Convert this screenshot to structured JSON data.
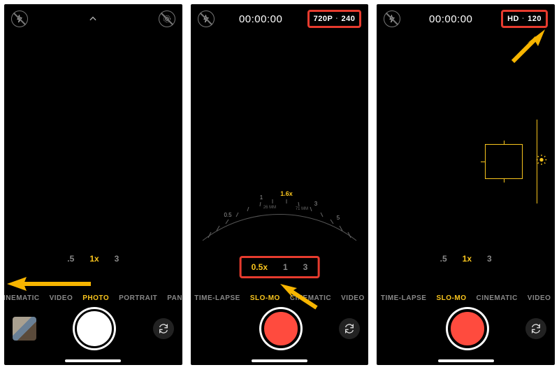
{
  "phone1": {
    "zoom": {
      "a": ".5",
      "b": "1x",
      "c": "3"
    },
    "modes": {
      "a": "CINEMATIC",
      "b": "VIDEO",
      "c": "PHOTO",
      "d": "PORTRAIT",
      "e": "PANO"
    }
  },
  "phone2": {
    "timer": "00:00:00",
    "res_a": "720P",
    "res_b": "240",
    "dial": {
      "l05": "0.5",
      "l1": "1",
      "l16": "1.6x",
      "l16mm": "26 MM",
      "l71mm": "71 MM",
      "l3": "3",
      "l5": "5"
    },
    "zoom": {
      "a": "0.5x",
      "b": "1",
      "c": "3"
    },
    "modes": {
      "a": "TIME-LAPSE",
      "b": "SLO-MO",
      "c": "CINEMATIC",
      "d": "VIDEO"
    }
  },
  "phone3": {
    "timer": "00:00:00",
    "res_a": "HD",
    "res_b": "120",
    "zoom": {
      "a": ".5",
      "b": "1x",
      "c": "3"
    },
    "modes": {
      "a": "TIME-LAPSE",
      "b": "SLO-MO",
      "c": "CINEMATIC",
      "d": "VIDEO"
    }
  }
}
